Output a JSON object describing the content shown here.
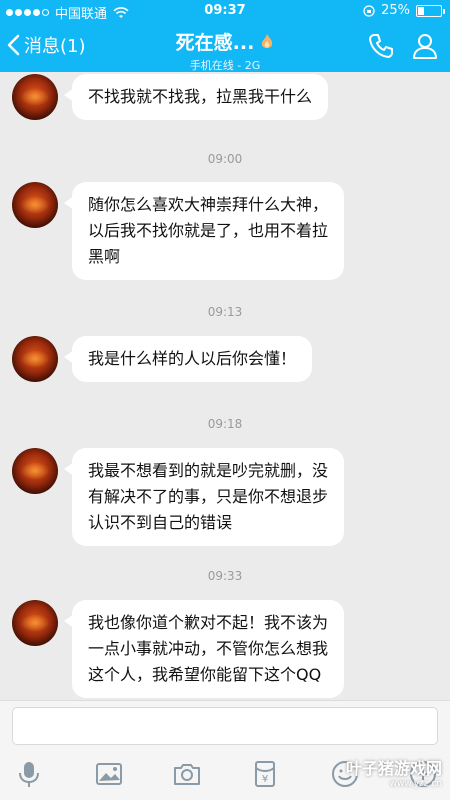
{
  "status_bar": {
    "carrier": "中国联通",
    "time": "09:37",
    "battery_percent": 25,
    "battery_text": "25%"
  },
  "nav": {
    "back_label": "消息(1)",
    "title": "死在感...",
    "subtitle": "手机在线 - 2G"
  },
  "messages": [
    {
      "type": "bubble",
      "text": "不找我就不找我，拉黑我干什么"
    },
    {
      "type": "time",
      "text": "09:00"
    },
    {
      "type": "bubble",
      "lines": [
        "随你怎么喜欢大神崇拜什么大神，",
        "以后我不找你就是了，也用不着拉",
        "黑啊"
      ]
    },
    {
      "type": "time",
      "text": "09:13"
    },
    {
      "type": "bubble",
      "text": "我是什么样的人以后你会懂！"
    },
    {
      "type": "time",
      "text": "09:18"
    },
    {
      "type": "bubble",
      "lines": [
        "我最不想看到的就是吵完就删，没",
        "有解决不了的事，只是你不想退步",
        "认识不到自己的错误"
      ]
    },
    {
      "type": "time",
      "text": "09:33"
    },
    {
      "type": "bubble",
      "lines": [
        "我也像你道个歉对不起！我不该为",
        "一点小事就冲动，不管你怎么想我",
        "这个人，我希望你能留下这个QQ"
      ]
    }
  ],
  "input": {
    "placeholder": ""
  },
  "toolbar_icons": [
    "microphone-icon",
    "image-icon",
    "camera-icon",
    "red-packet-icon",
    "emoji-icon"
  ],
  "watermark": {
    "main": "叶子猪游戏网",
    "sub": "www.yzz.cn"
  },
  "colors": {
    "nav_bg": "#12b7f5",
    "chat_bg": "#ebebeb",
    "bubble_bg": "#ffffff",
    "icon_gray": "#8a9aa6"
  }
}
